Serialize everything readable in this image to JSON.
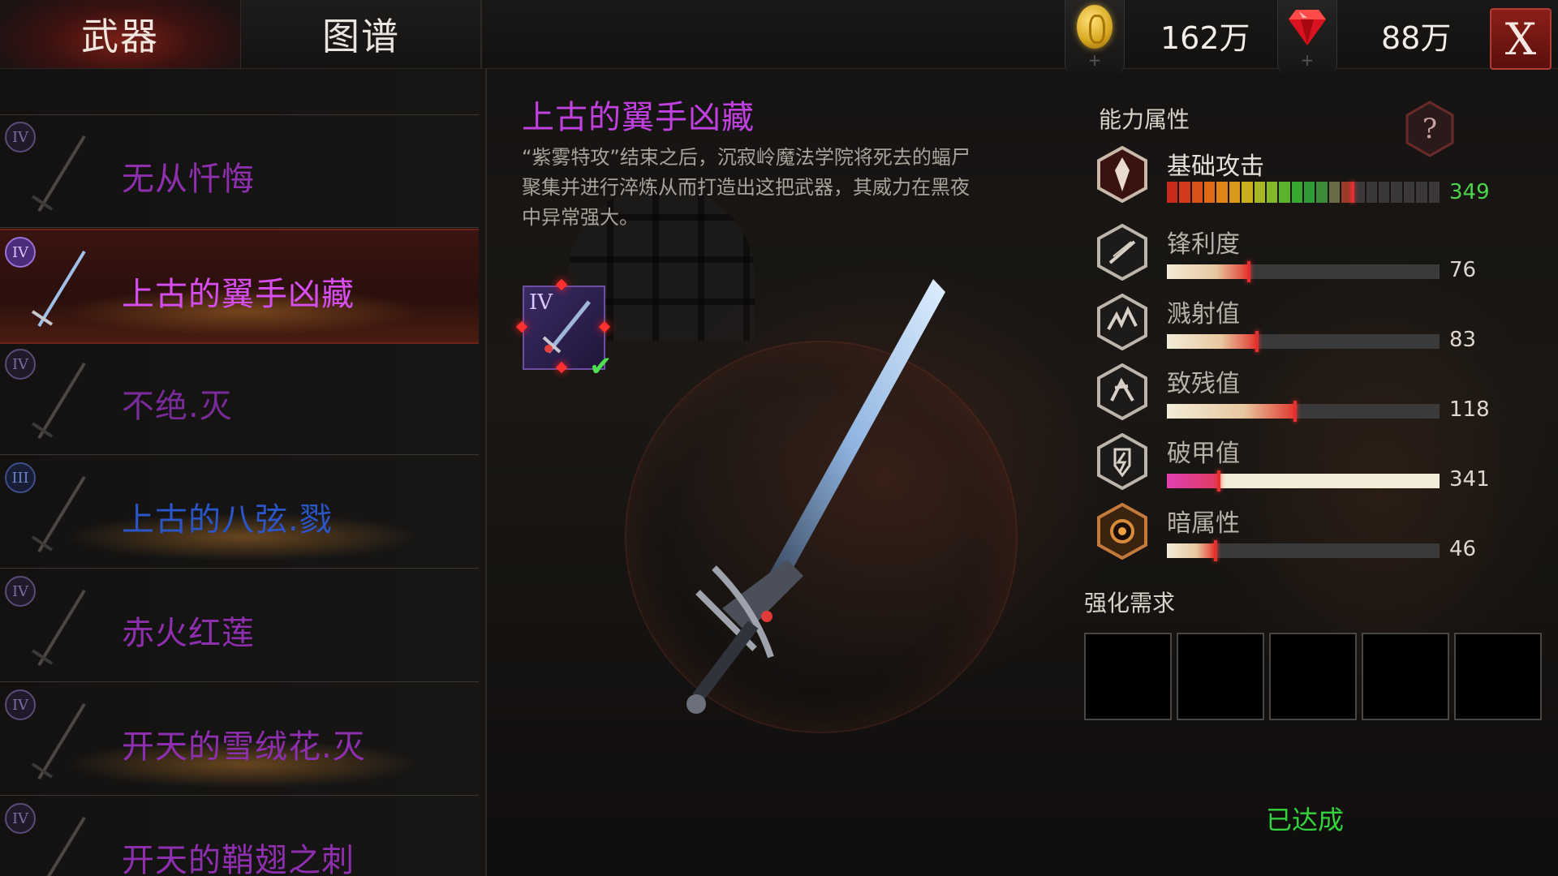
{
  "tabs": [
    {
      "label": "武器",
      "active": true
    },
    {
      "label": "图谱",
      "active": false
    }
  ],
  "currency": {
    "gold": "162万",
    "gems": "88万"
  },
  "close_label": "X",
  "weapon_list": [
    {
      "tier": "IV",
      "name": "无从忏悔",
      "color": "#8e2fb0",
      "selected": false
    },
    {
      "tier": "IV",
      "name": "上古的翼手凶藏",
      "color": "#d64ef0",
      "selected": true
    },
    {
      "tier": "IV",
      "name": "不绝.灭",
      "color": "#7a2b9a",
      "selected": false
    },
    {
      "tier": "III",
      "name": "上古的八弦.戮",
      "color": "#2a56c8",
      "selected": false
    },
    {
      "tier": "IV",
      "name": "赤火红莲",
      "color": "#8e2fb0",
      "selected": false
    },
    {
      "tier": "IV",
      "name": "开天的雪绒花.灭",
      "color": "#8e2fb0",
      "selected": false
    },
    {
      "tier": "IV",
      "name": "开天的鞘翅之刺",
      "color": "#8e2fb0",
      "selected": false
    }
  ],
  "detail": {
    "title": "上古的翼手凶藏",
    "description": "“紫雾特攻”结束之后，沉寂岭魔法学院将死去的蝠尸聚集并进行淬炼从而打造出这把武器，其威力在黑夜中异常强大。",
    "slot_tier": "IV"
  },
  "stats": {
    "title": "能力属性",
    "base_attack": {
      "label": "基础攻击",
      "value": "349",
      "fraction": 0.7
    },
    "rows": [
      {
        "label": "锋利度",
        "value": "76",
        "fraction": 0.3,
        "icon": "sharpness-icon"
      },
      {
        "label": "溅射值",
        "value": "83",
        "fraction": 0.33,
        "icon": "splash-icon"
      },
      {
        "label": "致残值",
        "value": "118",
        "fraction": 0.47,
        "icon": "cripple-icon"
      },
      {
        "label": "破甲值",
        "value": "341",
        "fraction": 0.19,
        "icon": "armor-break-icon"
      },
      {
        "label": "暗属性",
        "value": "46",
        "fraction": 0.18,
        "icon": "dark-element-icon"
      }
    ]
  },
  "upgrade": {
    "title": "强化需求",
    "slot_count": 5,
    "status": "已达成"
  }
}
